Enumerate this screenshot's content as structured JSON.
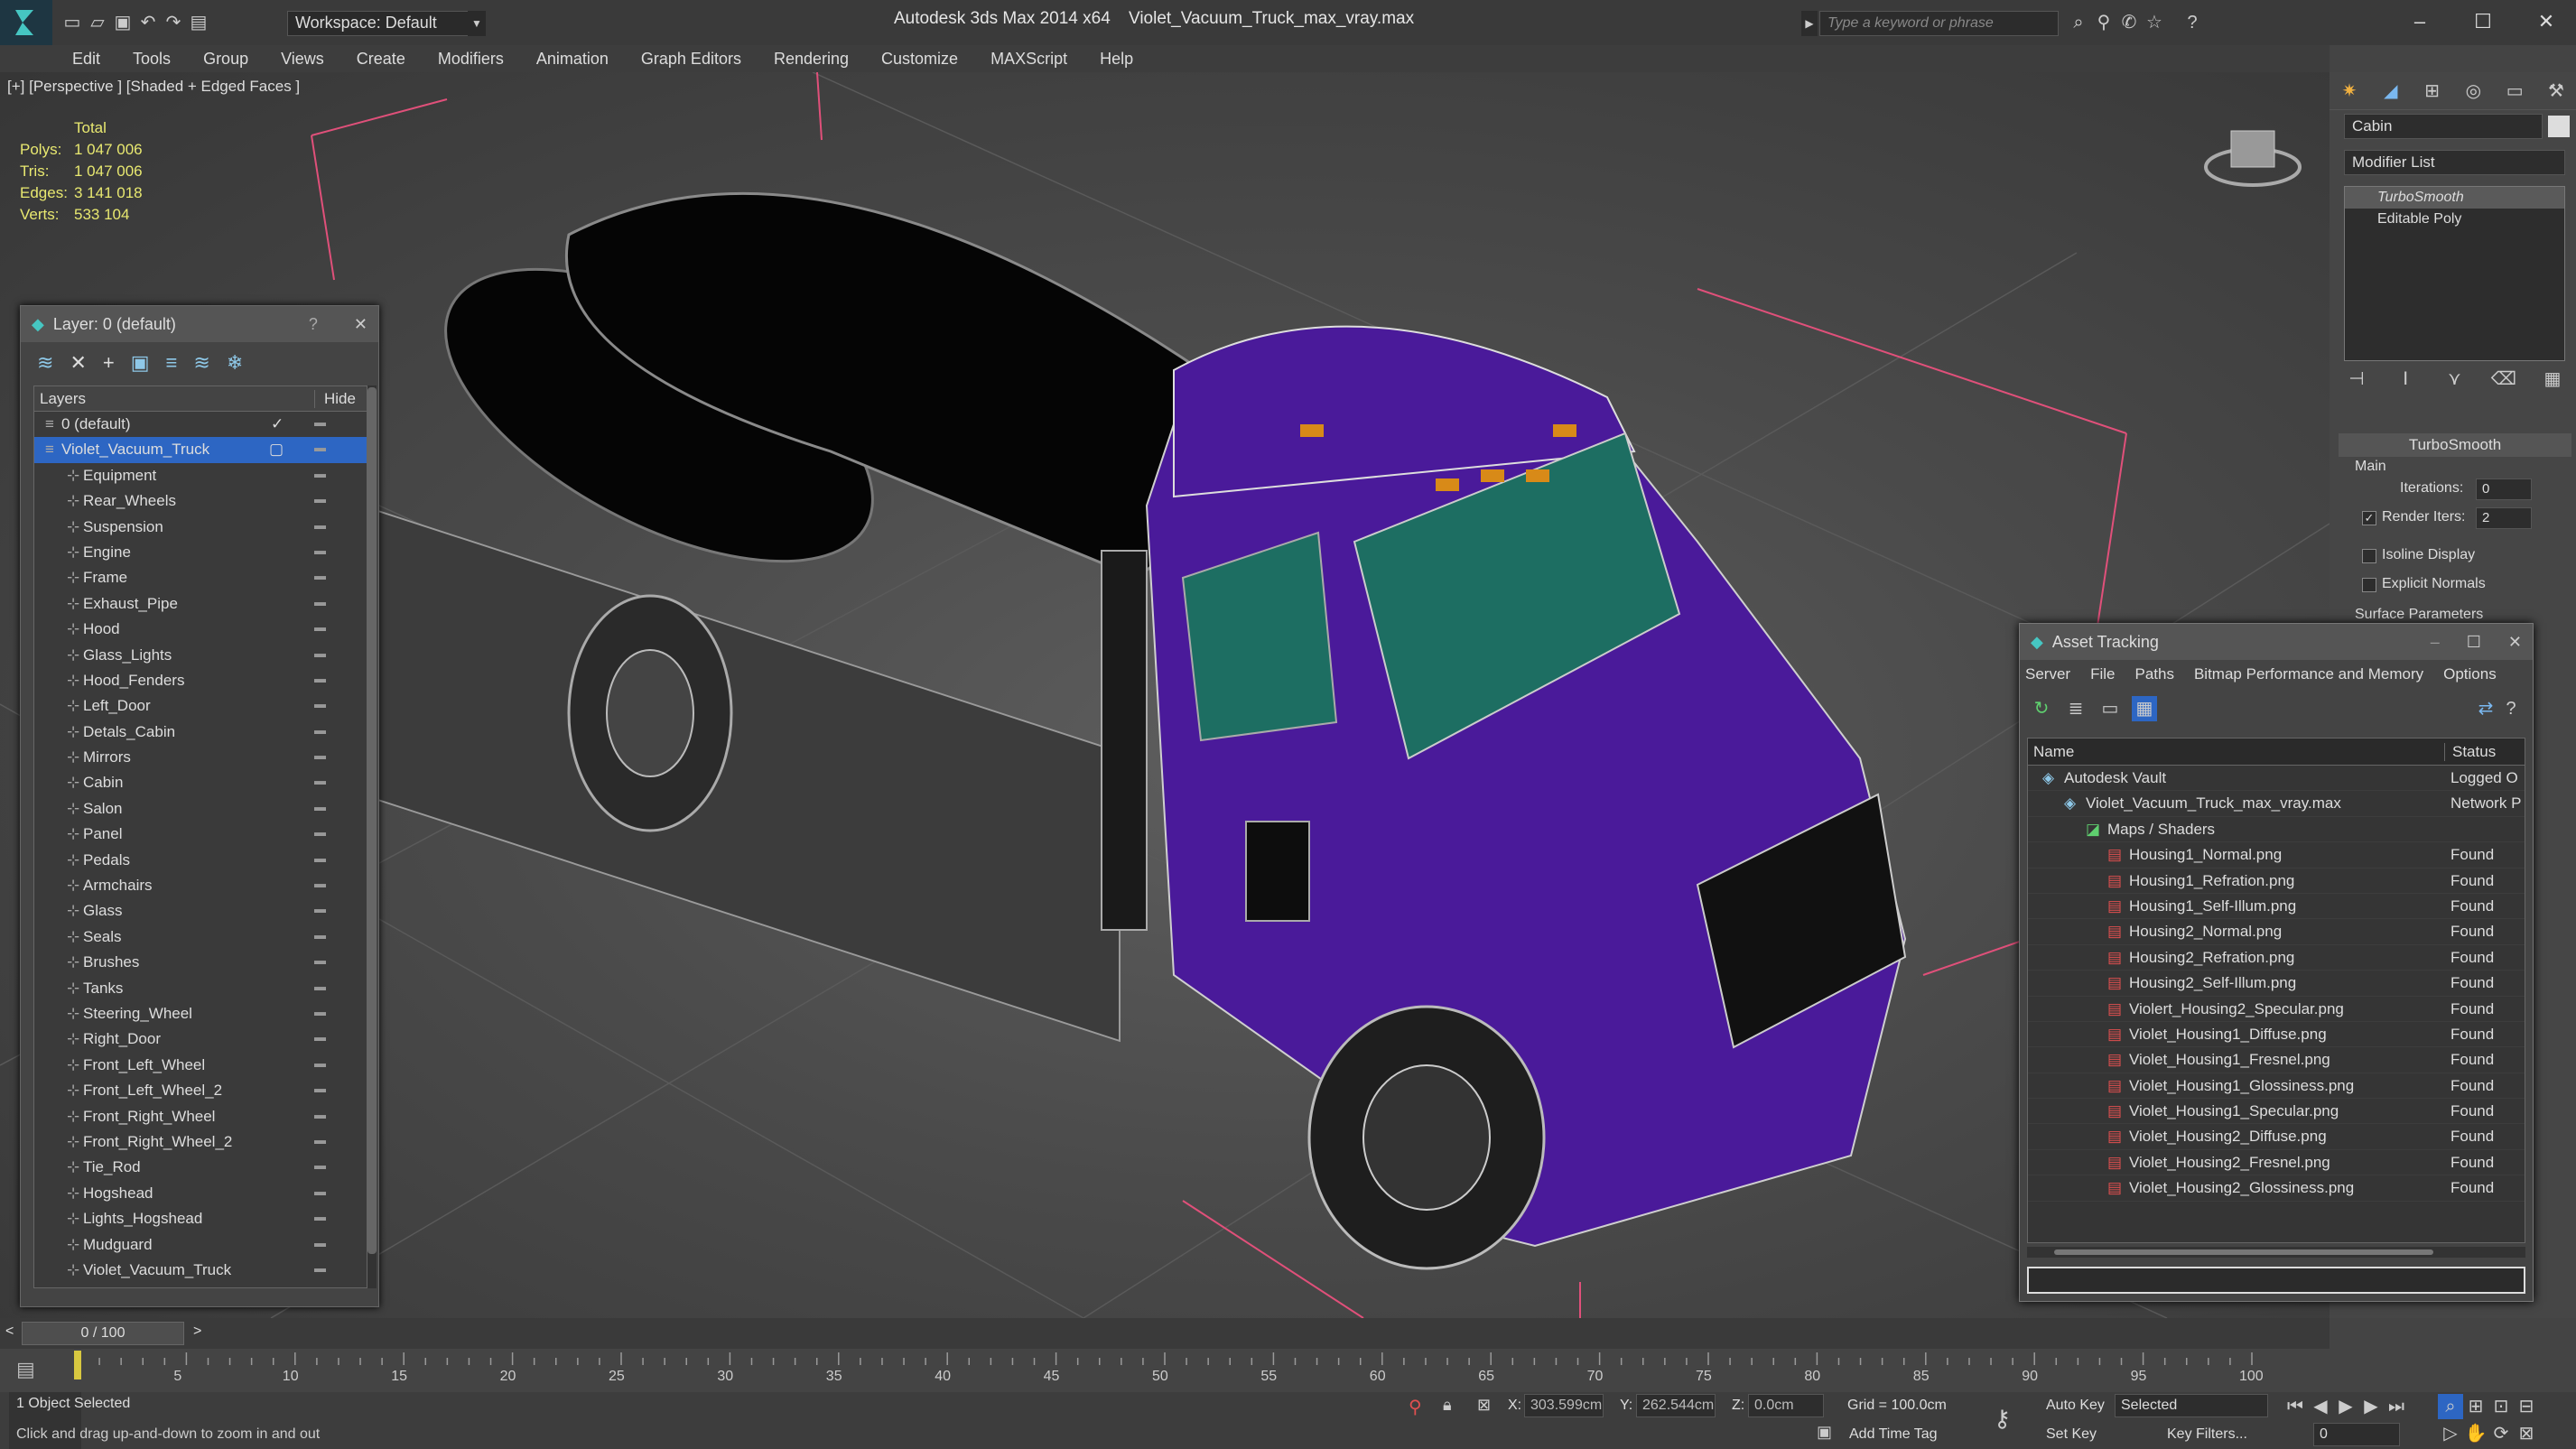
{
  "app": {
    "title": "Autodesk 3ds Max  2014 x64",
    "document": "Violet_Vacuum_Truck_max_vray.max",
    "workspace": "Workspace: Default",
    "search_placeholder": "Type a keyword or phrase"
  },
  "menu": [
    "Edit",
    "Tools",
    "Group",
    "Views",
    "Create",
    "Modifiers",
    "Animation",
    "Graph Editors",
    "Rendering",
    "Customize",
    "MAXScript",
    "Help"
  ],
  "viewport": {
    "label": "[+] [Perspective ] [Shaded + Edged Faces ]",
    "stats": {
      "header": "Total",
      "rows": [
        {
          "k": "Polys:",
          "v": "1 047 006"
        },
        {
          "k": "Tris:",
          "v": "1 047 006"
        },
        {
          "k": "Edges:",
          "v": "3 141 018"
        },
        {
          "k": "Verts:",
          "v": "533 104"
        }
      ]
    }
  },
  "layers": {
    "title": "Layer: 0 (default)",
    "help": "?",
    "col_layers": "Layers",
    "col_hide": "Hide",
    "items": [
      "0 (default)",
      "Violet_Vacuum_Truck",
      "Equipment",
      "Rear_Wheels",
      "Suspension",
      "Engine",
      "Frame",
      "Exhaust_Pipe",
      "Hood",
      "Glass_Lights",
      "Hood_Fenders",
      "Left_Door",
      "Detals_Cabin",
      "Mirrors",
      "Cabin",
      "Salon",
      "Panel",
      "Pedals",
      "Armchairs",
      "Glass",
      "Seals",
      "Brushes",
      "Tanks",
      "Steering_Wheel",
      "Right_Door",
      "Front_Left_Wheel",
      "Front_Left_Wheel_2",
      "Front_Right_Wheel",
      "Front_Right_Wheel_2",
      "Tie_Rod",
      "Hogshead",
      "Lights_Hogshead",
      "Mudguard",
      "Violet_Vacuum_Truck"
    ]
  },
  "command": {
    "object_name": "Cabin",
    "modifier_list": "Modifier List",
    "stack": [
      "TurboSmooth",
      "Editable Poly"
    ],
    "rollout": "TurboSmooth",
    "main": "Main",
    "iterations_label": "Iterations:",
    "iterations": "0",
    "render_iters_label": "Render Iters:",
    "render_iters": "2",
    "isoline": "Isoline Display",
    "explicit": "Explicit Normals",
    "surface": "Surface Parameters"
  },
  "asset": {
    "title": "Asset Tracking",
    "menu": [
      "Server",
      "File",
      "Paths",
      "Bitmap Performance and Memory",
      "Options"
    ],
    "col_name": "Name",
    "col_status": "Status",
    "rows": [
      {
        "name": "Autodesk Vault",
        "status": "Logged O",
        "indent": 0
      },
      {
        "name": "Violet_Vacuum_Truck_max_vray.max",
        "status": "Network P",
        "indent": 1
      },
      {
        "name": "Maps / Shaders",
        "status": "",
        "indent": 2
      },
      {
        "name": "Housing1_Normal.png",
        "status": "Found",
        "indent": 3
      },
      {
        "name": "Housing1_Refration.png",
        "status": "Found",
        "indent": 3
      },
      {
        "name": "Housing1_Self-Illum.png",
        "status": "Found",
        "indent": 3
      },
      {
        "name": "Housing2_Normal.png",
        "status": "Found",
        "indent": 3
      },
      {
        "name": "Housing2_Refration.png",
        "status": "Found",
        "indent": 3
      },
      {
        "name": "Housing2_Self-Illum.png",
        "status": "Found",
        "indent": 3
      },
      {
        "name": "Violert_Housing2_Specular.png",
        "status": "Found",
        "indent": 3
      },
      {
        "name": "Violet_Housing1_Diffuse.png",
        "status": "Found",
        "indent": 3
      },
      {
        "name": "Violet_Housing1_Fresnel.png",
        "status": "Found",
        "indent": 3
      },
      {
        "name": "Violet_Housing1_Glossiness.png",
        "status": "Found",
        "indent": 3
      },
      {
        "name": "Violet_Housing1_Specular.png",
        "status": "Found",
        "indent": 3
      },
      {
        "name": "Violet_Housing2_Diffuse.png",
        "status": "Found",
        "indent": 3
      },
      {
        "name": "Violet_Housing2_Fresnel.png",
        "status": "Found",
        "indent": 3
      },
      {
        "name": "Violet_Housing2_Glossiness.png",
        "status": "Found",
        "indent": 3
      }
    ]
  },
  "timeline": {
    "frame": "0 / 100",
    "ticks": [
      "5",
      "10",
      "15",
      "20",
      "25",
      "30",
      "35",
      "40",
      "45",
      "50",
      "55",
      "60",
      "65",
      "70",
      "75",
      "80",
      "85",
      "90",
      "95",
      "100"
    ]
  },
  "status": {
    "selected": "1 Object Selected",
    "prompt": "Click and drag up-and-down to zoom in and out",
    "x": "303.599cm",
    "y": "262.544cm",
    "z": "0.0cm",
    "grid": "Grid = 100.0cm",
    "autokey": "Auto Key",
    "selected_dd": "Selected",
    "setkey": "Set Key",
    "keyfilters": "Key Filters...",
    "addtimetag": "Add Time Tag",
    "frame": "0",
    "x_label": "X:",
    "y_label": "Y:",
    "z_label": "Z:"
  },
  "colors": {
    "truck_violet": "#4a1a9a",
    "glass": "#1d6e62",
    "selection": "#2d66c3",
    "grid_line": "#e0507a"
  }
}
